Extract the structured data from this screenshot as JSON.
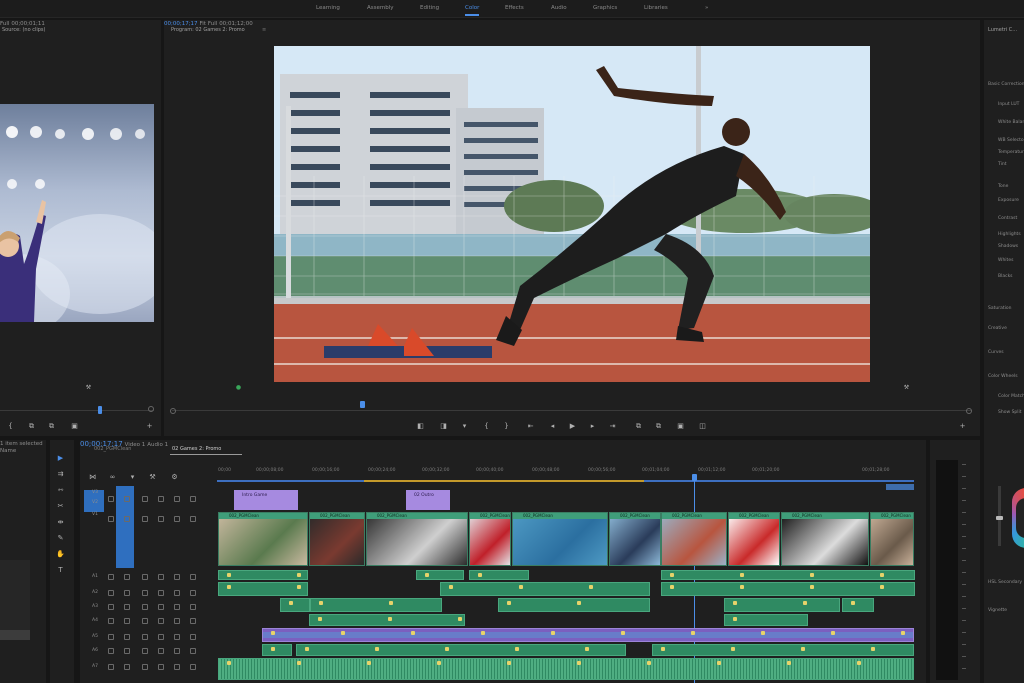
{
  "workspaces": [
    "Learning",
    "Assembly",
    "Editing",
    "Color",
    "Effects",
    "Audio",
    "Graphics",
    "Libraries"
  ],
  "active_workspace": "Color",
  "workspace_menu_glyph": "»",
  "source_monitor": {
    "title": "Source: (no clips)",
    "fit": "Full",
    "timecode": "00;00;01;11"
  },
  "program_monitor": {
    "title": "Program: 02 Games 2: Promo",
    "timecode": "00;00;17;17",
    "fit": "Fit",
    "zoom": "Full",
    "duration": "00;01;12;00"
  },
  "lumetri": {
    "title": "Lumetri C...",
    "items": [
      "Basic Correction",
      "Input LUT",
      "White Balance",
      "WB Selector",
      "Temperature",
      "Tint",
      "Tone",
      "Exposure",
      "Contrast",
      "Highlights",
      "Shadows",
      "Whites",
      "Blacks",
      "Saturation",
      "Creative",
      "Curves",
      "Color Wheels",
      "Color Match",
      "Show Split",
      "HSL Secondary",
      "Vignette"
    ]
  },
  "project_panel": {
    "selected_text": "1 item selected",
    "name_label": "Name"
  },
  "timeline": {
    "tabs": [
      "002_PGMClean",
      "02 Games 2: Promo"
    ],
    "active_tab": "02 Games 2: Promo",
    "timecode": "00;00;17;17",
    "ruler": [
      "00;00",
      "00;00;08;00",
      "00;00;16;00",
      "00;00;24;00",
      "00;00;32;00",
      "00;00;40;00",
      "00;00;48;00",
      "00;00;56;00",
      "00;01;04;00",
      "00;01;12;00",
      "00;01;20;00",
      "00;01;28;00"
    ],
    "tracks": [
      "V3",
      "V2",
      "V1",
      "A1",
      "A2",
      "A3",
      "A4",
      "A5",
      "A6",
      "A7"
    ],
    "video_track_label": "Video 1",
    "audio_track_label": "Audio 1",
    "graphic_clips": [
      "Intro Game",
      "02 Outro"
    ],
    "clip_label": "002_PGMClean"
  },
  "colors": {
    "accent": "#4b8ee8",
    "video_clip": "#3f9e7a",
    "audio_clip": "#2f8a62",
    "graphic_clip": "#a68ae0",
    "nested_clip": "#7b5fbf"
  }
}
